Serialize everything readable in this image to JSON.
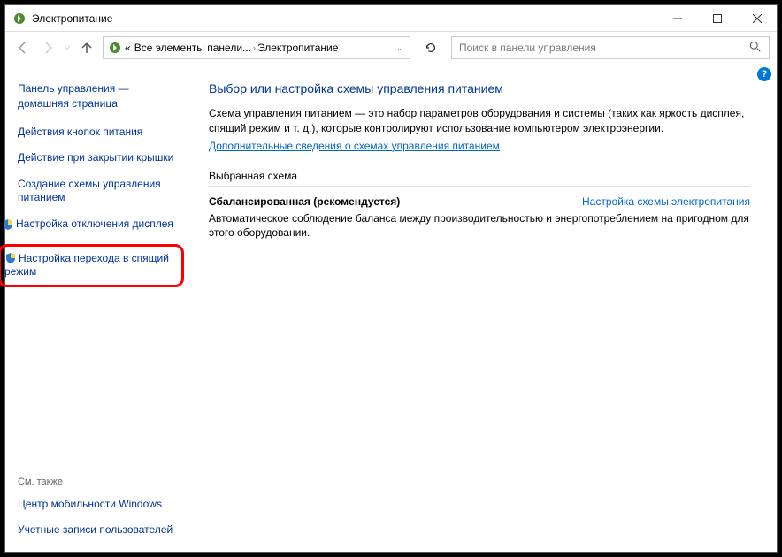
{
  "window": {
    "title": "Электропитание"
  },
  "breadcrumb": {
    "prefix": "«",
    "item1": "Все элементы панели...",
    "item2": "Электропитание"
  },
  "search": {
    "placeholder": "Поиск в панели управления"
  },
  "sidebar": {
    "home": "Панель управления — домашняя страница",
    "link1": "Действия кнопок питания",
    "link2": "Действие при закрытии крышки",
    "link3": "Создание схемы управления питанием",
    "link4": "Настройка отключения дисплея",
    "link5": "Настройка перехода в спящий режим",
    "footer_label": "См. также",
    "footer1": "Центр мобильности Windows",
    "footer2": "Учетные записи пользователей"
  },
  "main": {
    "heading": "Выбор или настройка схемы управления питанием",
    "desc": "Схема управления питанием — это набор параметров оборудования и системы (таких как яркость дисплея, спящий режим и т. д.), которые контролируют использование компьютером электроэнергии.",
    "more_link": "Дополнительные сведения о схемах управления питанием",
    "section": "Выбранная схема",
    "plan_name": "Сбалансированная (рекомендуется)",
    "plan_link": "Настройка схемы электропитания",
    "plan_desc": "Автоматическое соблюдение баланса между производительностью и энергопотреблением на пригодном для этого оборудовании."
  },
  "help": "?"
}
